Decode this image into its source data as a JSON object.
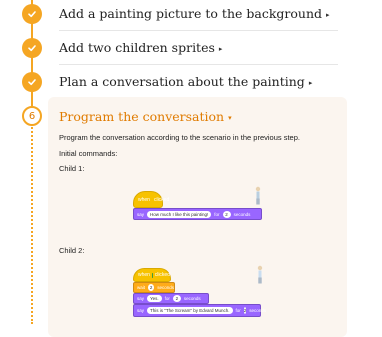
{
  "steps": [
    {
      "title": "Add a painting picture to the background",
      "status": "done"
    },
    {
      "title": "Add two children sprites",
      "status": "done"
    },
    {
      "title": "Plan a conversation about the painting",
      "status": "done"
    }
  ],
  "current_step": {
    "number": "6",
    "title": "Program the conversation",
    "description": "Program the conversation according to the scenario in the previous step.",
    "initial_label": "Initial commands:",
    "child1_label": "Child 1:",
    "child2_label": "Child 2:"
  },
  "child1_blocks": {
    "hat": {
      "when": "when",
      "clicked": "clicked"
    },
    "say": {
      "say": "say",
      "text": "How much I like this painting!",
      "for": "for",
      "secs": "2",
      "seconds": "seconds"
    }
  },
  "child2_blocks": {
    "hat": {
      "when": "when",
      "clicked": "clicked"
    },
    "wait": {
      "wait": "wait",
      "secs": "2",
      "seconds": "seconds"
    },
    "say1": {
      "say": "say",
      "text": "Yes.",
      "for": "for",
      "secs": "2",
      "seconds": "seconds"
    },
    "say2": {
      "say": "say",
      "text": "This is \"The Scream\" by Edvard Munch.",
      "for": "for",
      "secs": "2",
      "seconds": "seconds"
    }
  },
  "colors": {
    "accent": "#f5a623",
    "current_title": "#e07b00",
    "panel": "#fbf5ef",
    "looks": "#9966ff",
    "events": "#f7c200",
    "control": "#ffab19"
  },
  "icons": {
    "done": "check-icon",
    "expand": "caret-icon"
  }
}
